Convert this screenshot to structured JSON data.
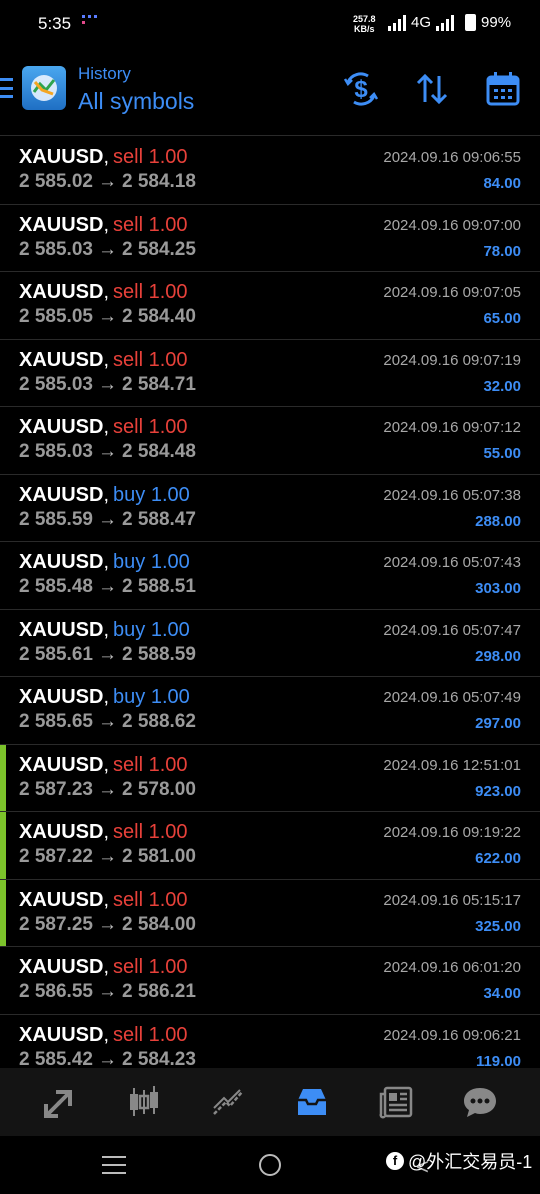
{
  "status": {
    "time": "5:35",
    "netspeed_value": "257.8",
    "netspeed_unit": "KB/s",
    "network": "4G",
    "battery": "99%"
  },
  "header": {
    "subtitle": "History",
    "title": "All symbols"
  },
  "icons": {
    "menu": "menu-icon",
    "logo": "metatrader-logo-icon",
    "deposit": "dollar-refresh-icon",
    "sort": "sort-icon",
    "calendar": "calendar-icon"
  },
  "colors": {
    "accent": "#3d8df5",
    "sell": "#e8413a",
    "buy": "#3d8df5",
    "marker": "#7cc32b"
  },
  "trades": [
    {
      "symbol": "XAUUSD",
      "type": "sell",
      "volume": "1.00",
      "open": "2 585.02",
      "close": "2 584.18",
      "time": "2024.09.16 09:06:55",
      "profit": "84.00",
      "marked": false
    },
    {
      "symbol": "XAUUSD",
      "type": "sell",
      "volume": "1.00",
      "open": "2 585.03",
      "close": "2 584.25",
      "time": "2024.09.16 09:07:00",
      "profit": "78.00",
      "marked": false
    },
    {
      "symbol": "XAUUSD",
      "type": "sell",
      "volume": "1.00",
      "open": "2 585.05",
      "close": "2 584.40",
      "time": "2024.09.16 09:07:05",
      "profit": "65.00",
      "marked": false
    },
    {
      "symbol": "XAUUSD",
      "type": "sell",
      "volume": "1.00",
      "open": "2 585.03",
      "close": "2 584.71",
      "time": "2024.09.16 09:07:19",
      "profit": "32.00",
      "marked": false
    },
    {
      "symbol": "XAUUSD",
      "type": "sell",
      "volume": "1.00",
      "open": "2 585.03",
      "close": "2 584.48",
      "time": "2024.09.16 09:07:12",
      "profit": "55.00",
      "marked": false
    },
    {
      "symbol": "XAUUSD",
      "type": "buy",
      "volume": "1.00",
      "open": "2 585.59",
      "close": "2 588.47",
      "time": "2024.09.16 05:07:38",
      "profit": "288.00",
      "marked": false
    },
    {
      "symbol": "XAUUSD",
      "type": "buy",
      "volume": "1.00",
      "open": "2 585.48",
      "close": "2 588.51",
      "time": "2024.09.16 05:07:43",
      "profit": "303.00",
      "marked": false
    },
    {
      "symbol": "XAUUSD",
      "type": "buy",
      "volume": "1.00",
      "open": "2 585.61",
      "close": "2 588.59",
      "time": "2024.09.16 05:07:47",
      "profit": "298.00",
      "marked": false
    },
    {
      "symbol": "XAUUSD",
      "type": "buy",
      "volume": "1.00",
      "open": "2 585.65",
      "close": "2 588.62",
      "time": "2024.09.16 05:07:49",
      "profit": "297.00",
      "marked": false
    },
    {
      "symbol": "XAUUSD",
      "type": "sell",
      "volume": "1.00",
      "open": "2 587.23",
      "close": "2 578.00",
      "time": "2024.09.16 12:51:01",
      "profit": "923.00",
      "marked": true
    },
    {
      "symbol": "XAUUSD",
      "type": "sell",
      "volume": "1.00",
      "open": "2 587.22",
      "close": "2 581.00",
      "time": "2024.09.16 09:19:22",
      "profit": "622.00",
      "marked": true
    },
    {
      "symbol": "XAUUSD",
      "type": "sell",
      "volume": "1.00",
      "open": "2 587.25",
      "close": "2 584.00",
      "time": "2024.09.16 05:15:17",
      "profit": "325.00",
      "marked": true
    },
    {
      "symbol": "XAUUSD",
      "type": "sell",
      "volume": "1.00",
      "open": "2 586.55",
      "close": "2 586.21",
      "time": "2024.09.16 06:01:20",
      "profit": "34.00",
      "marked": false
    },
    {
      "symbol": "XAUUSD",
      "type": "sell",
      "volume": "1.00",
      "open": "2 585.42",
      "close": "2 584.23",
      "time": "2024.09.16 09:06:21",
      "profit": "119.00",
      "marked": false
    }
  ],
  "bottom_nav": [
    {
      "name": "quotes",
      "icon": "quotes-arrows-icon",
      "active": false
    },
    {
      "name": "chart",
      "icon": "candlestick-icon",
      "active": false
    },
    {
      "name": "trade",
      "icon": "trade-line-icon",
      "active": false
    },
    {
      "name": "history",
      "icon": "inbox-tray-icon",
      "active": true
    },
    {
      "name": "news",
      "icon": "newspaper-icon",
      "active": false
    },
    {
      "name": "messages",
      "icon": "chat-bubble-icon",
      "active": false
    }
  ],
  "watermark": {
    "text": "@外汇交易员-1"
  }
}
